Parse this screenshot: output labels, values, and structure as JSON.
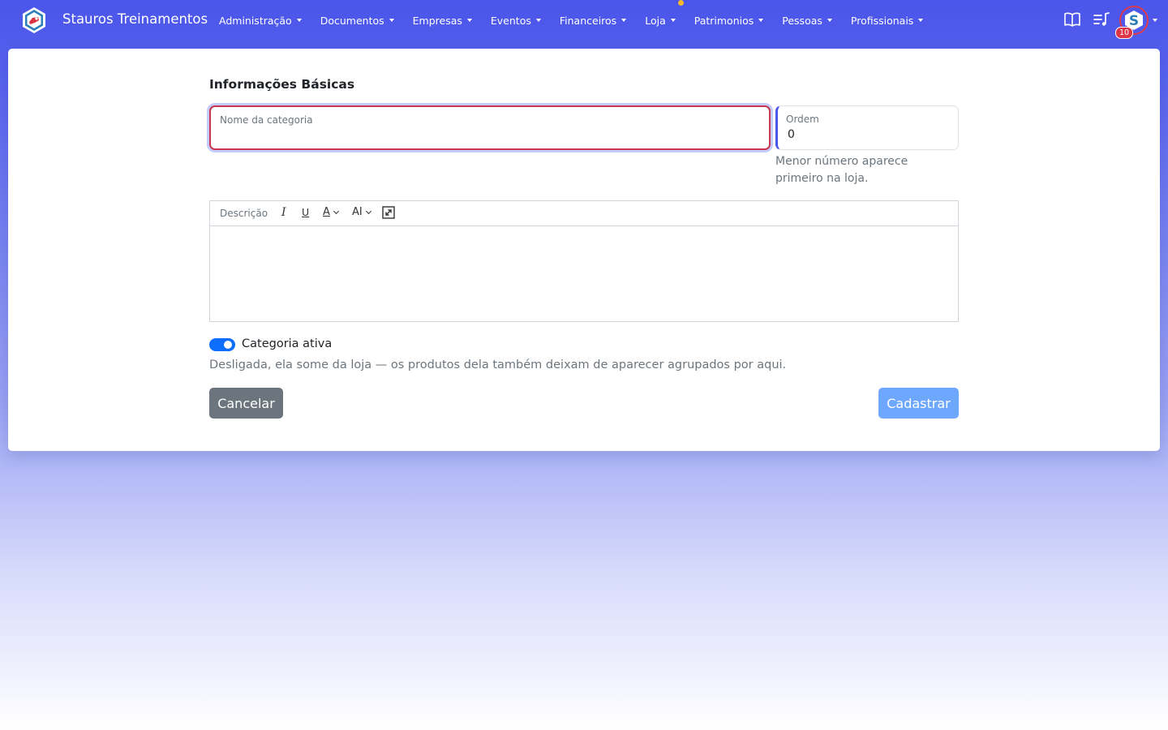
{
  "navbar": {
    "brand_name": "Stauros Treinamentos",
    "menu": [
      {
        "label": "Administração",
        "has_dot": false
      },
      {
        "label": "Documentos",
        "has_dot": false
      },
      {
        "label": "Empresas",
        "has_dot": false
      },
      {
        "label": "Eventos",
        "has_dot": false
      },
      {
        "label": "Financeiros",
        "has_dot": false
      },
      {
        "label": "Loja",
        "has_dot": true
      },
      {
        "label": "Patrimonios",
        "has_dot": false
      },
      {
        "label": "Pessoas",
        "has_dot": false
      },
      {
        "label": "Profissionais",
        "has_dot": false
      }
    ],
    "icons": [
      "book-open-icon",
      "music-list-icon"
    ],
    "avatar_badge": "10"
  },
  "form": {
    "section_title": "Informações Básicas",
    "name_field": {
      "label": "Nome da categoria",
      "value": ""
    },
    "order_field": {
      "label": "Ordem",
      "value": "0"
    },
    "order_help": "Menor número aparece primeiro na loja.",
    "editor": {
      "placeholder": "Descrição",
      "size_label": "AI"
    },
    "active_toggle": {
      "label": "Categoria ativa",
      "on": true
    },
    "active_help": "Desligada, ela some da loja — os produtos dela também deixam de aparecer agrupados por aqui.",
    "cancel_label": "Cancelar",
    "submit_label": "Cadastrar"
  },
  "colors": {
    "navbar_bg": "#4a55ea",
    "accent": "#0d6efd",
    "invalid": "#c9364d",
    "submit": "#6ea8fe",
    "cancel": "#6c757d"
  }
}
